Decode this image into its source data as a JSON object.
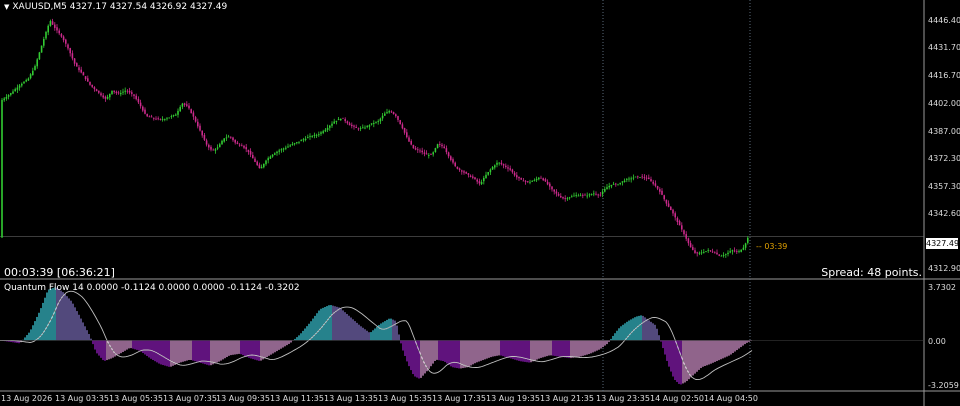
{
  "header": {
    "symbol_info": "XAUUSD,M5  4327.17 4327.54 4326.92 4327.49"
  },
  "price_axis": {
    "ticks": [
      "4446.40",
      "4431.70",
      "4416.70",
      "4402.00",
      "4387.00",
      "4372.30",
      "4357.30",
      "4342.60",
      "4327.49",
      "4312.90"
    ],
    "current_price": "4327.49"
  },
  "countdown_label": "-- 03:39",
  "timer_text": "00:03:39 [06:36:21]",
  "spread_text": "Spread: 48 points.",
  "indicator": {
    "header": "Quantum Flow  14 0.0000 -0.1124 0.0000 0.0000 -0.1124 -0.3202",
    "ticks": [
      "3.7302",
      "0.00",
      "-3.2059"
    ]
  },
  "time_axis": {
    "ticks": [
      "13 Aug 2026",
      "13 Aug 03:35",
      "13 Aug 05:35",
      "13 Aug 07:35",
      "13 Aug 09:35",
      "13 Aug 11:35",
      "13 Aug 13:35",
      "13 Aug 15:35",
      "13 Aug 17:35",
      "13 Aug 19:35",
      "13 Aug 21:35",
      "13 Aug 23:35",
      "14 Aug 02:50",
      "14 Aug 04:50"
    ]
  },
  "colors": {
    "background": "#000000",
    "bull_candle": "#33cc33",
    "bear_candle": "#cc2a8c",
    "hist_cyan": "#40d8e8",
    "hist_purple": "#a020d0",
    "hist_pink": "#f0a8e8",
    "signal_line": "#c0c0c0"
  },
  "chart_data": {
    "type": "candlestick",
    "price_path": [
      [
        0,
        4401
      ],
      [
        10,
        4405
      ],
      [
        20,
        4410
      ],
      [
        28,
        4413
      ],
      [
        35,
        4420
      ],
      [
        42,
        4432
      ],
      [
        50,
        4445
      ],
      [
        56,
        4440
      ],
      [
        62,
        4436
      ],
      [
        68,
        4430
      ],
      [
        75,
        4421
      ],
      [
        82,
        4416
      ],
      [
        90,
        4410
      ],
      [
        98,
        4406
      ],
      [
        106,
        4402
      ],
      [
        112,
        4407
      ],
      [
        118,
        4405
      ],
      [
        126,
        4407
      ],
      [
        134,
        4404
      ],
      [
        140,
        4399
      ],
      [
        146,
        4393
      ],
      [
        152,
        4392
      ],
      [
        160,
        4391
      ],
      [
        168,
        4392
      ],
      [
        176,
        4394
      ],
      [
        182,
        4400
      ],
      [
        188,
        4398
      ],
      [
        194,
        4392
      ],
      [
        200,
        4385
      ],
      [
        206,
        4378
      ],
      [
        212,
        4374
      ],
      [
        218,
        4376
      ],
      [
        224,
        4381
      ],
      [
        230,
        4382
      ],
      [
        236,
        4378
      ],
      [
        242,
        4377
      ],
      [
        248,
        4374
      ],
      [
        254,
        4369
      ],
      [
        260,
        4364
      ],
      [
        266,
        4369
      ],
      [
        272,
        4372
      ],
      [
        278,
        4374
      ],
      [
        286,
        4376
      ],
      [
        294,
        4378
      ],
      [
        302,
        4380
      ],
      [
        310,
        4382
      ],
      [
        318,
        4383
      ],
      [
        326,
        4386
      ],
      [
        334,
        4390
      ],
      [
        342,
        4392
      ],
      [
        350,
        4388
      ],
      [
        358,
        4386
      ],
      [
        366,
        4387
      ],
      [
        372,
        4389
      ],
      [
        378,
        4390
      ],
      [
        384,
        4394
      ],
      [
        390,
        4396
      ],
      [
        396,
        4393
      ],
      [
        402,
        4387
      ],
      [
        408,
        4380
      ],
      [
        414,
        4375
      ],
      [
        420,
        4374
      ],
      [
        426,
        4372
      ],
      [
        432,
        4372
      ],
      [
        438,
        4378
      ],
      [
        444,
        4376
      ],
      [
        450,
        4370
      ],
      [
        456,
        4365
      ],
      [
        462,
        4363
      ],
      [
        468,
        4361
      ],
      [
        474,
        4359
      ],
      [
        480,
        4356
      ],
      [
        486,
        4361
      ],
      [
        492,
        4365
      ],
      [
        498,
        4368
      ],
      [
        504,
        4366
      ],
      [
        510,
        4364
      ],
      [
        516,
        4360
      ],
      [
        522,
        4358
      ],
      [
        528,
        4357
      ],
      [
        534,
        4358
      ],
      [
        540,
        4360
      ],
      [
        546,
        4357
      ],
      [
        552,
        4353
      ],
      [
        558,
        4350
      ],
      [
        564,
        4348
      ],
      [
        570,
        4349
      ],
      [
        576,
        4350
      ],
      [
        582,
        4350
      ],
      [
        588,
        4350
      ],
      [
        594,
        4351
      ],
      [
        600,
        4350
      ],
      [
        606,
        4354
      ],
      [
        612,
        4356
      ],
      [
        618,
        4356
      ],
      [
        624,
        4358
      ],
      [
        630,
        4359
      ],
      [
        636,
        4360
      ],
      [
        642,
        4360
      ],
      [
        648,
        4359
      ],
      [
        654,
        4356
      ],
      [
        660,
        4352
      ],
      [
        666,
        4346
      ],
      [
        672,
        4341
      ],
      [
        678,
        4335
      ],
      [
        684,
        4329
      ],
      [
        690,
        4322
      ],
      [
        696,
        4318
      ],
      [
        702,
        4319
      ],
      [
        708,
        4320
      ],
      [
        714,
        4319
      ],
      [
        720,
        4317
      ],
      [
        726,
        4318
      ],
      [
        732,
        4320
      ],
      [
        738,
        4319
      ],
      [
        744,
        4322
      ],
      [
        748,
        4327
      ]
    ],
    "oscillator_path": [
      [
        0,
        0.0
      ],
      [
        20,
        -0.2
      ],
      [
        30,
        0.6
      ],
      [
        40,
        2.0
      ],
      [
        48,
        3.4
      ],
      [
        56,
        3.6
      ],
      [
        64,
        3.2
      ],
      [
        72,
        2.6
      ],
      [
        80,
        1.6
      ],
      [
        90,
        0.3
      ],
      [
        96,
        -0.8
      ],
      [
        104,
        -1.4
      ],
      [
        112,
        -1.2
      ],
      [
        120,
        -0.9
      ],
      [
        130,
        -0.5
      ],
      [
        140,
        -0.7
      ],
      [
        150,
        -1.2
      ],
      [
        160,
        -1.6
      ],
      [
        170,
        -1.8
      ],
      [
        180,
        -1.5
      ],
      [
        190,
        -1.3
      ],
      [
        200,
        -1.5
      ],
      [
        210,
        -1.7
      ],
      [
        220,
        -1.4
      ],
      [
        230,
        -1.0
      ],
      [
        240,
        -0.9
      ],
      [
        250,
        -1.2
      ],
      [
        260,
        -1.4
      ],
      [
        270,
        -1.0
      ],
      [
        280,
        -0.6
      ],
      [
        290,
        -0.2
      ],
      [
        300,
        0.4
      ],
      [
        310,
        1.2
      ],
      [
        320,
        2.1
      ],
      [
        330,
        2.4
      ],
      [
        340,
        2.2
      ],
      [
        350,
        1.6
      ],
      [
        360,
        1.0
      ],
      [
        370,
        0.5
      ],
      [
        380,
        1.1
      ],
      [
        390,
        1.5
      ],
      [
        396,
        1.3
      ],
      [
        402,
        -0.5
      ],
      [
        408,
        -1.6
      ],
      [
        414,
        -2.4
      ],
      [
        420,
        -2.6
      ],
      [
        428,
        -2.0
      ],
      [
        436,
        -1.3
      ],
      [
        444,
        -1.4
      ],
      [
        452,
        -1.8
      ],
      [
        460,
        -1.9
      ],
      [
        468,
        -1.8
      ],
      [
        476,
        -1.5
      ],
      [
        484,
        -1.3
      ],
      [
        492,
        -1.1
      ],
      [
        500,
        -1.0
      ],
      [
        510,
        -1.2
      ],
      [
        520,
        -1.4
      ],
      [
        530,
        -1.5
      ],
      [
        540,
        -1.2
      ],
      [
        550,
        -1.0
      ],
      [
        560,
        -1.1
      ],
      [
        570,
        -1.2
      ],
      [
        580,
        -1.1
      ],
      [
        590,
        -0.9
      ],
      [
        600,
        -0.6
      ],
      [
        608,
        -0.2
      ],
      [
        614,
        0.4
      ],
      [
        620,
        0.9
      ],
      [
        628,
        1.3
      ],
      [
        636,
        1.6
      ],
      [
        642,
        1.7
      ],
      [
        648,
        1.4
      ],
      [
        656,
        1.0
      ],
      [
        662,
        -0.3
      ],
      [
        668,
        -1.6
      ],
      [
        674,
        -2.6
      ],
      [
        680,
        -3.0
      ],
      [
        686,
        -2.8
      ],
      [
        694,
        -2.3
      ],
      [
        702,
        -1.8
      ],
      [
        710,
        -1.6
      ],
      [
        720,
        -1.3
      ],
      [
        730,
        -1.0
      ],
      [
        738,
        -0.6
      ],
      [
        746,
        -0.2
      ],
      [
        752,
        0.0
      ]
    ],
    "price_range": [
      4305,
      4455
    ],
    "oscillator_range": [
      -3.2059,
      3.7302
    ],
    "grid": false
  }
}
